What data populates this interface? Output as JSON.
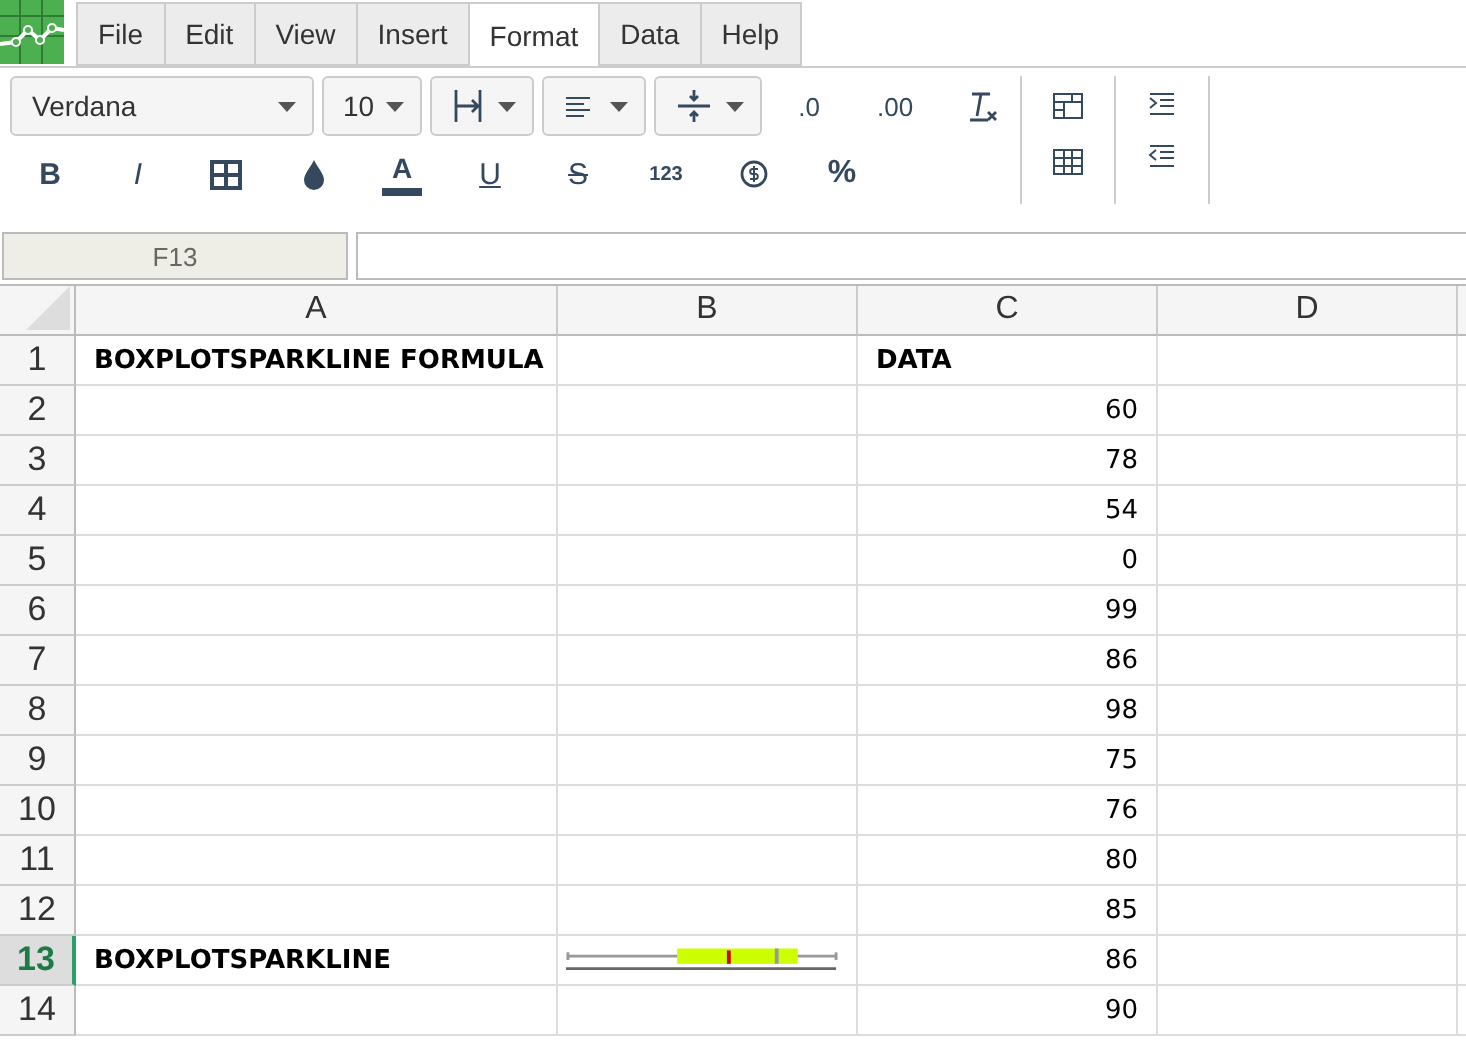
{
  "menu": [
    {
      "label": "File",
      "selected": false
    },
    {
      "label": "Edit",
      "selected": false
    },
    {
      "label": "View",
      "selected": false
    },
    {
      "label": "Insert",
      "selected": false
    },
    {
      "label": "Format",
      "selected": true
    },
    {
      "label": "Data",
      "selected": false
    },
    {
      "label": "Help",
      "selected": false
    }
  ],
  "toolbar": {
    "font": "Verdana",
    "size": "10",
    "labels": [
      "B",
      "I",
      "A",
      "U",
      "S",
      "123",
      "%",
      ".0",
      ".00"
    ]
  },
  "formula_bar": {
    "cell": "F13"
  },
  "columns": [
    {
      "label": "A",
      "selected": false
    },
    {
      "label": "B",
      "selected": false
    },
    {
      "label": "C",
      "selected": false
    },
    {
      "label": "D",
      "selected": false
    }
  ],
  "rows": [
    {
      "number": "1",
      "selected": false,
      "cells": [
        {
          "kind": "text",
          "bold": true,
          "text": "BOXPLOTSPARKLINE FORMULA"
        },
        {
          "kind": "empty"
        },
        {
          "kind": "text",
          "bold": true,
          "text": "DATA"
        },
        {
          "kind": "empty"
        }
      ]
    },
    {
      "number": "2",
      "selected": false,
      "cells": [
        {
          "kind": "empty"
        },
        {
          "kind": "empty"
        },
        {
          "kind": "number",
          "bold": false,
          "text": "60"
        },
        {
          "kind": "empty"
        }
      ]
    },
    {
      "number": "3",
      "selected": false,
      "cells": [
        {
          "kind": "empty"
        },
        {
          "kind": "empty"
        },
        {
          "kind": "number",
          "bold": false,
          "text": "78"
        },
        {
          "kind": "empty"
        }
      ]
    },
    {
      "number": "4",
      "selected": false,
      "cells": [
        {
          "kind": "empty"
        },
        {
          "kind": "empty"
        },
        {
          "kind": "number",
          "bold": false,
          "text": "54"
        },
        {
          "kind": "empty"
        }
      ]
    },
    {
      "number": "5",
      "selected": false,
      "cells": [
        {
          "kind": "empty"
        },
        {
          "kind": "empty"
        },
        {
          "kind": "number",
          "bold": false,
          "text": "0"
        },
        {
          "kind": "empty"
        }
      ]
    },
    {
      "number": "6",
      "selected": false,
      "cells": [
        {
          "kind": "empty"
        },
        {
          "kind": "empty"
        },
        {
          "kind": "number",
          "bold": false,
          "text": "99"
        },
        {
          "kind": "empty"
        }
      ]
    },
    {
      "number": "7",
      "selected": false,
      "cells": [
        {
          "kind": "empty"
        },
        {
          "kind": "empty"
        },
        {
          "kind": "number",
          "bold": false,
          "text": "86"
        },
        {
          "kind": "empty"
        }
      ]
    },
    {
      "number": "8",
      "selected": false,
      "cells": [
        {
          "kind": "empty"
        },
        {
          "kind": "empty"
        },
        {
          "kind": "number",
          "bold": false,
          "text": "98"
        },
        {
          "kind": "empty"
        }
      ]
    },
    {
      "number": "9",
      "selected": false,
      "cells": [
        {
          "kind": "empty"
        },
        {
          "kind": "empty"
        },
        {
          "kind": "number",
          "bold": false,
          "text": "75"
        },
        {
          "kind": "empty"
        }
      ]
    },
    {
      "number": "10",
      "selected": false,
      "cells": [
        {
          "kind": "empty"
        },
        {
          "kind": "empty"
        },
        {
          "kind": "number",
          "bold": false,
          "text": "76"
        },
        {
          "kind": "empty"
        }
      ]
    },
    {
      "number": "11",
      "selected": false,
      "cells": [
        {
          "kind": "empty"
        },
        {
          "kind": "empty"
        },
        {
          "kind": "number",
          "bold": false,
          "text": "80"
        },
        {
          "kind": "empty"
        }
      ]
    },
    {
      "number": "12",
      "selected": false,
      "cells": [
        {
          "kind": "empty"
        },
        {
          "kind": "empty"
        },
        {
          "kind": "number",
          "bold": false,
          "text": "85"
        },
        {
          "kind": "empty"
        }
      ]
    },
    {
      "number": "13",
      "selected": true,
      "cells": [
        {
          "kind": "text",
          "bold": true,
          "text": "BOXPLOTSPARKLINE"
        },
        {
          "kind": "boxplot"
        },
        {
          "kind": "number",
          "bold": false,
          "text": "86"
        },
        {
          "kind": "empty"
        }
      ]
    },
    {
      "number": "14",
      "selected": false,
      "cells": [
        {
          "kind": "empty"
        },
        {
          "kind": "empty"
        },
        {
          "kind": "number",
          "bold": false,
          "text": "90"
        },
        {
          "kind": "empty"
        }
      ]
    }
  ]
}
